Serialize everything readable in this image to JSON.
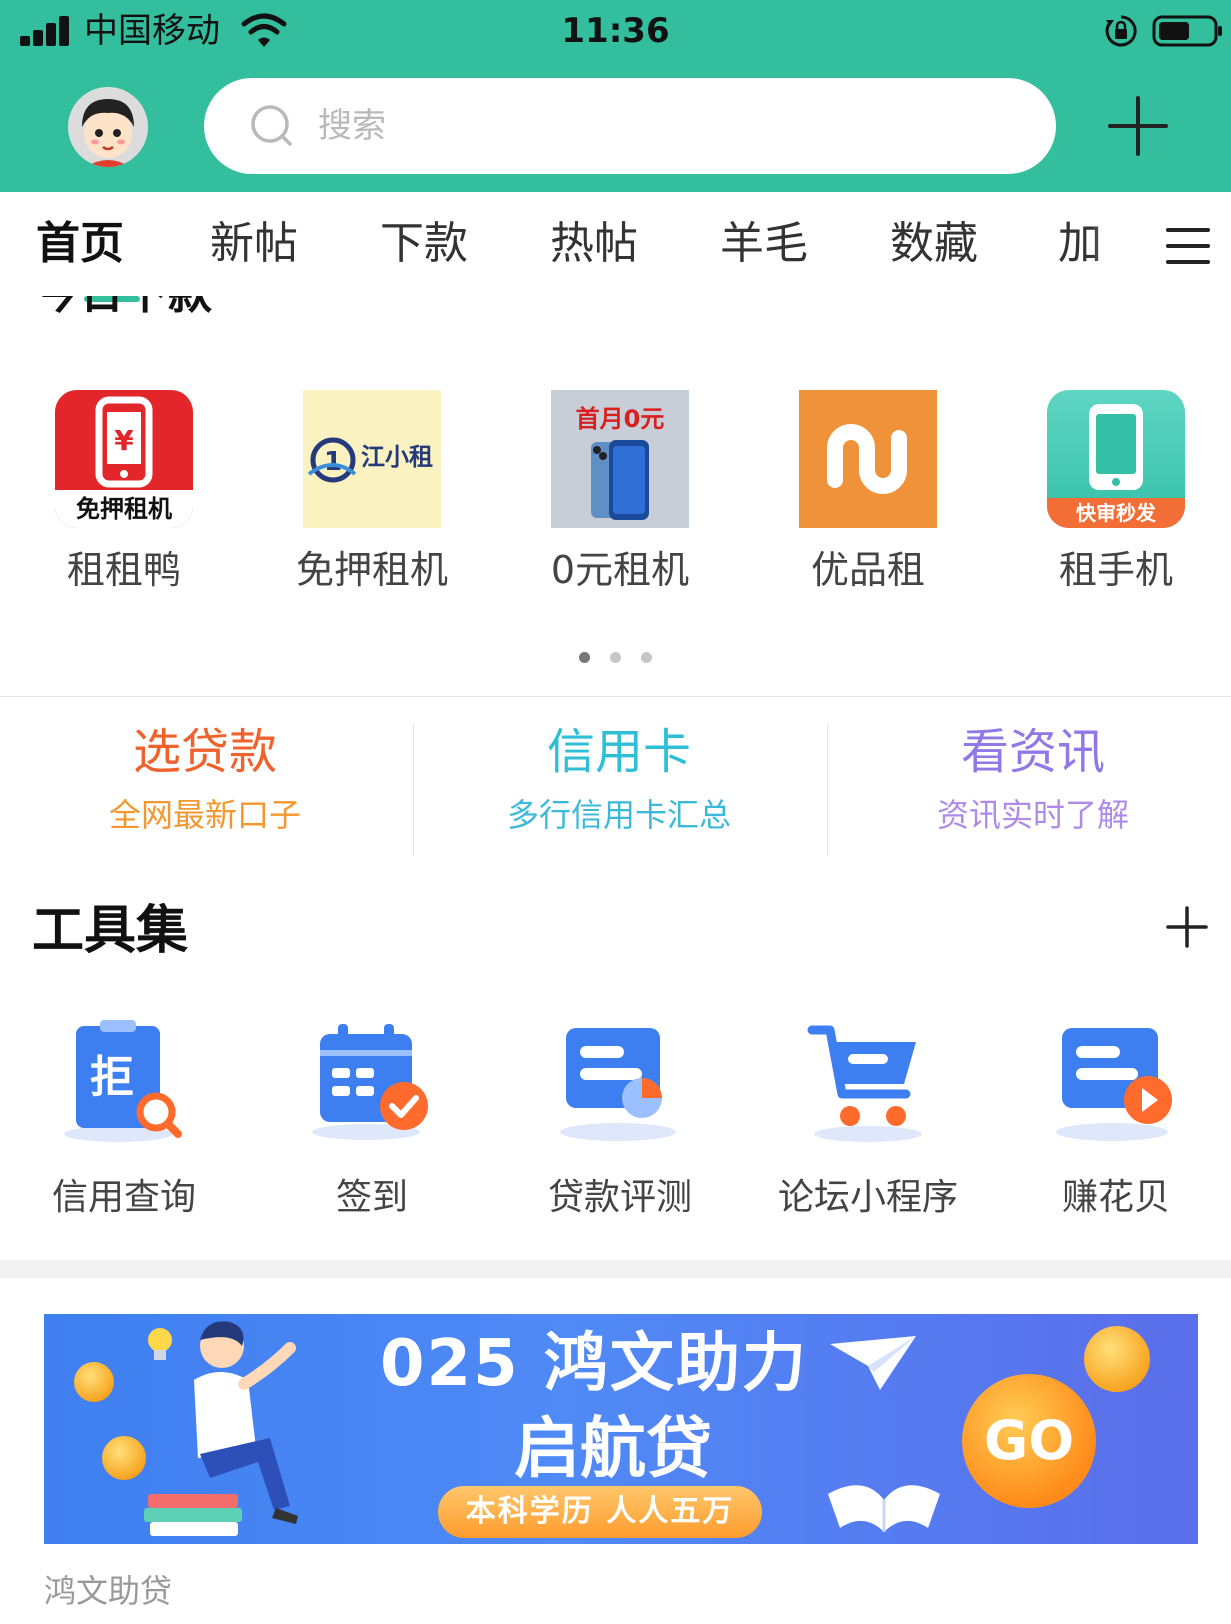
{
  "status_bar": {
    "carrier": "中国移动",
    "time": "11:36"
  },
  "header": {
    "search_placeholder": "搜索"
  },
  "tabs": [
    {
      "label": "首页",
      "active": true
    },
    {
      "label": "新帖",
      "active": false
    },
    {
      "label": "下款",
      "active": false
    },
    {
      "label": "热帖",
      "active": false
    },
    {
      "label": "羊毛",
      "active": false
    },
    {
      "label": "数藏",
      "active": false
    },
    {
      "label": "加",
      "active": false
    }
  ],
  "section_peek": {
    "title": "今日下款"
  },
  "apps": [
    {
      "label": "租租鸭",
      "icon": "zuzuya-app-icon",
      "icon_text": "免押租机"
    },
    {
      "label": "免押租机",
      "icon": "jiangxiaozu-app-icon",
      "icon_text": "江小租"
    },
    {
      "label": "0元租机",
      "icon": "phone-rental-app-icon",
      "icon_text": "首月0元"
    },
    {
      "label": "优品租",
      "icon": "youpinzu-app-icon",
      "icon_text": ""
    },
    {
      "label": "租手机",
      "icon": "zushouji-app-icon",
      "icon_text": "快审秒发"
    }
  ],
  "pager": {
    "count": 3,
    "active_index": 0
  },
  "features": [
    {
      "title": "选贷款",
      "subtitle": "全网最新口子",
      "title_color": "#f0622c",
      "subtitle_color": "#f4972e"
    },
    {
      "title": "信用卡",
      "subtitle": "多行信用卡汇总",
      "title_color": "#2ebfd6",
      "subtitle_color": "#3cb9d9"
    },
    {
      "title": "看资讯",
      "subtitle": "资讯实时了解",
      "title_color": "#8f79e6",
      "subtitle_color": "#ae8be8"
    }
  ],
  "tools": {
    "title": "工具集",
    "items": [
      {
        "label": "信用查询",
        "icon": "credit-check-icon"
      },
      {
        "label": "签到",
        "icon": "calendar-check-icon"
      },
      {
        "label": "贷款评测",
        "icon": "loan-evaluation-icon"
      },
      {
        "label": "论坛小程序",
        "icon": "cart-icon"
      },
      {
        "label": "赚花贝",
        "icon": "play-card-icon"
      }
    ]
  },
  "banner": {
    "line1": "025  鸿文助力",
    "line2": "启航贷",
    "pill": "本科学历  人人五万",
    "go": "GO",
    "caption": "鸿文助贷"
  },
  "colors": {
    "accent": "#33be9d",
    "tool_blue": "#3d7ff0",
    "tool_orange": "#ff6b2c"
  }
}
